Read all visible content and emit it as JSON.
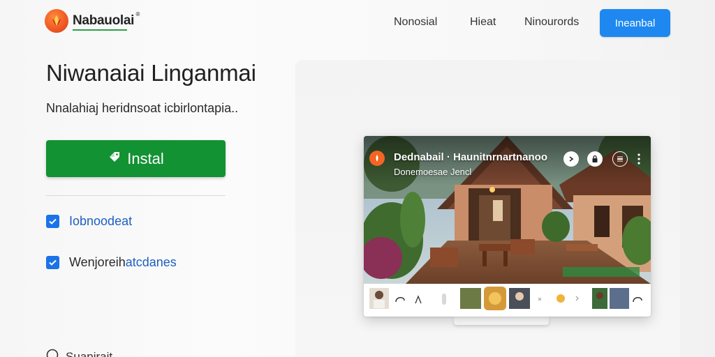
{
  "brand": {
    "name": "Nabauolai",
    "mark": "®"
  },
  "nav": {
    "items": [
      "Nonosial",
      "Hieat",
      "Ninourords"
    ],
    "cta_label": "Ineanbal"
  },
  "hero": {
    "title": "Niwanaiai Linganmai",
    "subtitle": "Nnalahiaj heridnsoat icbirlontapia..",
    "install_label": "Instal",
    "features": [
      {
        "label": "Iobnoodeat",
        "checked": true
      },
      {
        "label_prefix": "Wenjoreih",
        "label_accent": "atcdanes",
        "checked": true
      }
    ],
    "support_label": "Suapirait"
  },
  "preview": {
    "video_title": "Dednabail · Haunitnrnartnanoo",
    "video_subtitle": "Donemoesae Jencl",
    "controls": [
      "chevron-icon",
      "lock-icon",
      "settings-icon",
      "more-icon"
    ]
  },
  "colors": {
    "accent_blue": "#1e88f0",
    "install_green": "#129232",
    "check_blue": "#1a73e8",
    "brand_orange": "#f15a24"
  }
}
